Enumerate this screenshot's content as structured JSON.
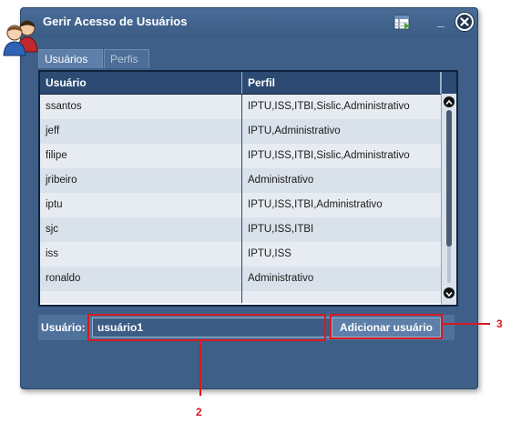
{
  "window": {
    "title": "Gerir Acesso de Usuários",
    "minimize_glyph": "_",
    "icons": {
      "app": "users-icon",
      "settings": "grid-settings-icon",
      "close": "close-icon"
    }
  },
  "tabs": [
    {
      "label": "Usuários",
      "active": true
    },
    {
      "label": "Perfis",
      "active": false
    }
  ],
  "table": {
    "columns": [
      "Usuário",
      "Perfil"
    ],
    "rows": [
      {
        "user": "ssantos",
        "profile": "IPTU,ISS,ITBI,Sislic,Administrativo"
      },
      {
        "user": "jeff",
        "profile": "IPTU,Administrativo"
      },
      {
        "user": "filipe",
        "profile": "IPTU,ISS,ITBI,Sislic,Administrativo"
      },
      {
        "user": "jribeiro",
        "profile": "Administrativo"
      },
      {
        "user": "iptu",
        "profile": "IPTU,ISS,ITBI,Administrativo"
      },
      {
        "user": "sjc",
        "profile": "IPTU,ISS,ITBI"
      },
      {
        "user": "iss",
        "profile": "IPTU,ISS"
      },
      {
        "user": "ronaldo",
        "profile": "Administrativo"
      },
      {
        "user": "",
        "profile": ""
      }
    ]
  },
  "form": {
    "label": "Usuário:",
    "input_value": "usuário1",
    "add_button": "Adicionar usuário"
  },
  "annotations": {
    "input_callout": "2",
    "button_callout": "3"
  },
  "colors": {
    "window_bg": "#3d5f88",
    "header_bg": "#2c4a72",
    "highlight": "#d71920"
  }
}
